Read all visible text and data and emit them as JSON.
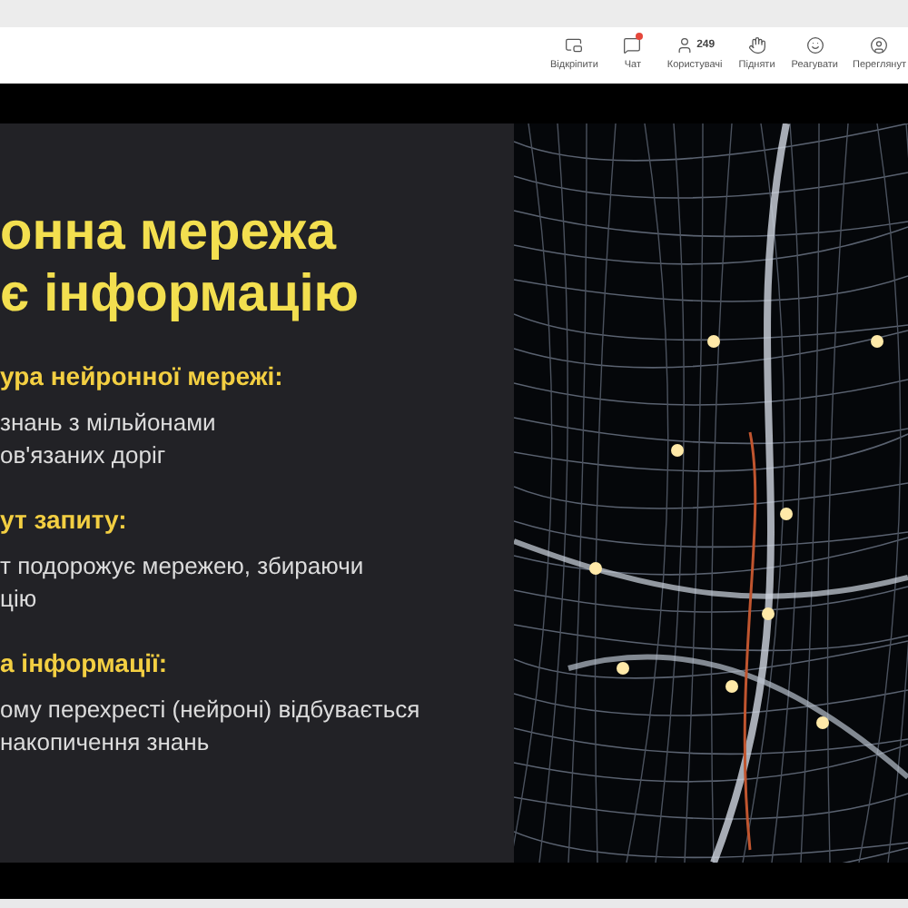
{
  "toolbar": {
    "items": [
      {
        "kind": "unpin",
        "label": "Відкріпити"
      },
      {
        "kind": "chat",
        "label": "Чат",
        "unread": true
      },
      {
        "kind": "users",
        "label": "Користувачі",
        "count": "249"
      },
      {
        "kind": "raise",
        "label": "Підняти"
      },
      {
        "kind": "react",
        "label": "Реагувати"
      },
      {
        "kind": "view",
        "label": "Переглянут"
      }
    ]
  },
  "slide": {
    "title_lines": [
      "онна мережа",
      "є інформацію"
    ],
    "sections": [
      {
        "heading": "ура нейронної мережі:",
        "lines": [
          "знань з мільйонами",
          "ов'язаних доріг"
        ]
      },
      {
        "heading": "ут запиту:",
        "lines": [
          "т подорожує мережею, збираючи",
          "цію"
        ]
      },
      {
        "heading": "а інформації:",
        "lines": [
          "ому перехресті (нейроні) відбувається",
          "накопичення знань"
        ]
      }
    ]
  }
}
